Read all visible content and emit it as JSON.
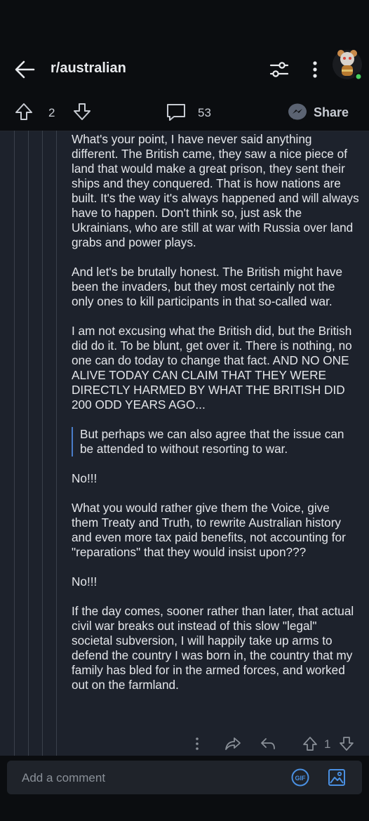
{
  "header": {
    "subreddit": "r/australian",
    "back_icon": "arrow-left-icon",
    "filter_icon": "sliders-icon",
    "menu_icon": "kebab-menu-icon",
    "avatar_status_color": "#46d160"
  },
  "post_actions": {
    "vote_count": "2",
    "comment_count": "53",
    "share_label": "Share"
  },
  "comment": {
    "paragraphs": [
      "What's your point, I have never said anything different. The British came, they saw a nice piece of land that would make a great prison, they sent their ships and they conquered. That is how nations are built. It's the way it's always happened and will always have to happen. Don't think so, just ask the Ukrainians, who are still at war with Russia over land grabs and power plays.",
      "And let's be brutally honest. The British might have been the invaders, but they most certainly not the only ones to kill participants in that so-called war.",
      "I am not excusing what the British did, but the British did do it. To be blunt, get over it. There is nothing, no one can do today to change that fact. AND NO ONE ALIVE TODAY  CAN CLAIM THAT THEY WERE DIRECTLY HARMED BY WHAT THE BRITISH DID 200 ODD YEARS AGO..."
    ],
    "quote": "But perhaps we can also agree that the issue can be attended to without resorting to war.",
    "reply_1": "No!!!",
    "paragraph_4": "What you would rather give them the Voice, give them Treaty and Truth, to rewrite Australian history and even more tax paid benefits, not accounting for \"reparations\" that they would insist upon???",
    "reply_2": "No!!!",
    "paragraph_5": "If the day comes, sooner rather than later, that actual civil war breaks out instead of this slow \"legal\" societal subversion, I will happily take up arms to defend the country I was born in, the country that my family has bled for in the armed forces, and worked out on the farmland.",
    "vote_count": "1"
  },
  "composer": {
    "placeholder": "Add a comment",
    "gif_label": "GIF"
  },
  "colors": {
    "background": "#1d222c",
    "bar": "#0b0d10",
    "quote_accent": "#4a7dc9",
    "share_icon": "#5b6372"
  }
}
